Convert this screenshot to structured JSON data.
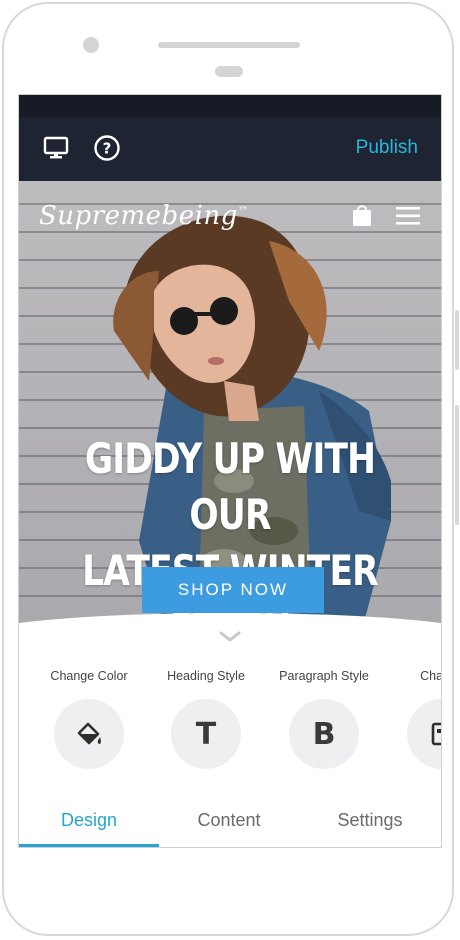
{
  "topbar": {
    "publish_label": "Publish",
    "icons": [
      "desktop-preview-icon",
      "help-icon"
    ]
  },
  "hero": {
    "brand": "Supremebeing",
    "brand_mark": "™",
    "heading_line1": "GIDDY UP WITH OUR",
    "heading_line2": "LATEST WINTER STASH",
    "cta_label": "SHOP NOW",
    "icons": [
      "shopping-bag-icon",
      "hamburger-menu-icon"
    ]
  },
  "tools": [
    {
      "label": "Change Color",
      "icon": "paint-bucket-icon"
    },
    {
      "label": "Heading Style",
      "icon": "heading-t-icon",
      "glyph": "T"
    },
    {
      "label": "Paragraph Style",
      "icon": "bold-b-icon",
      "glyph": "B"
    },
    {
      "label": "Change",
      "icon": "layout-icon"
    }
  ],
  "tabs": [
    {
      "label": "Design",
      "active": true
    },
    {
      "label": "Content",
      "active": false
    },
    {
      "label": "Settings",
      "active": false
    }
  ],
  "colors": {
    "accent": "#27a5cf",
    "topbar": "#1e2432",
    "cta": "#3d9be0"
  }
}
